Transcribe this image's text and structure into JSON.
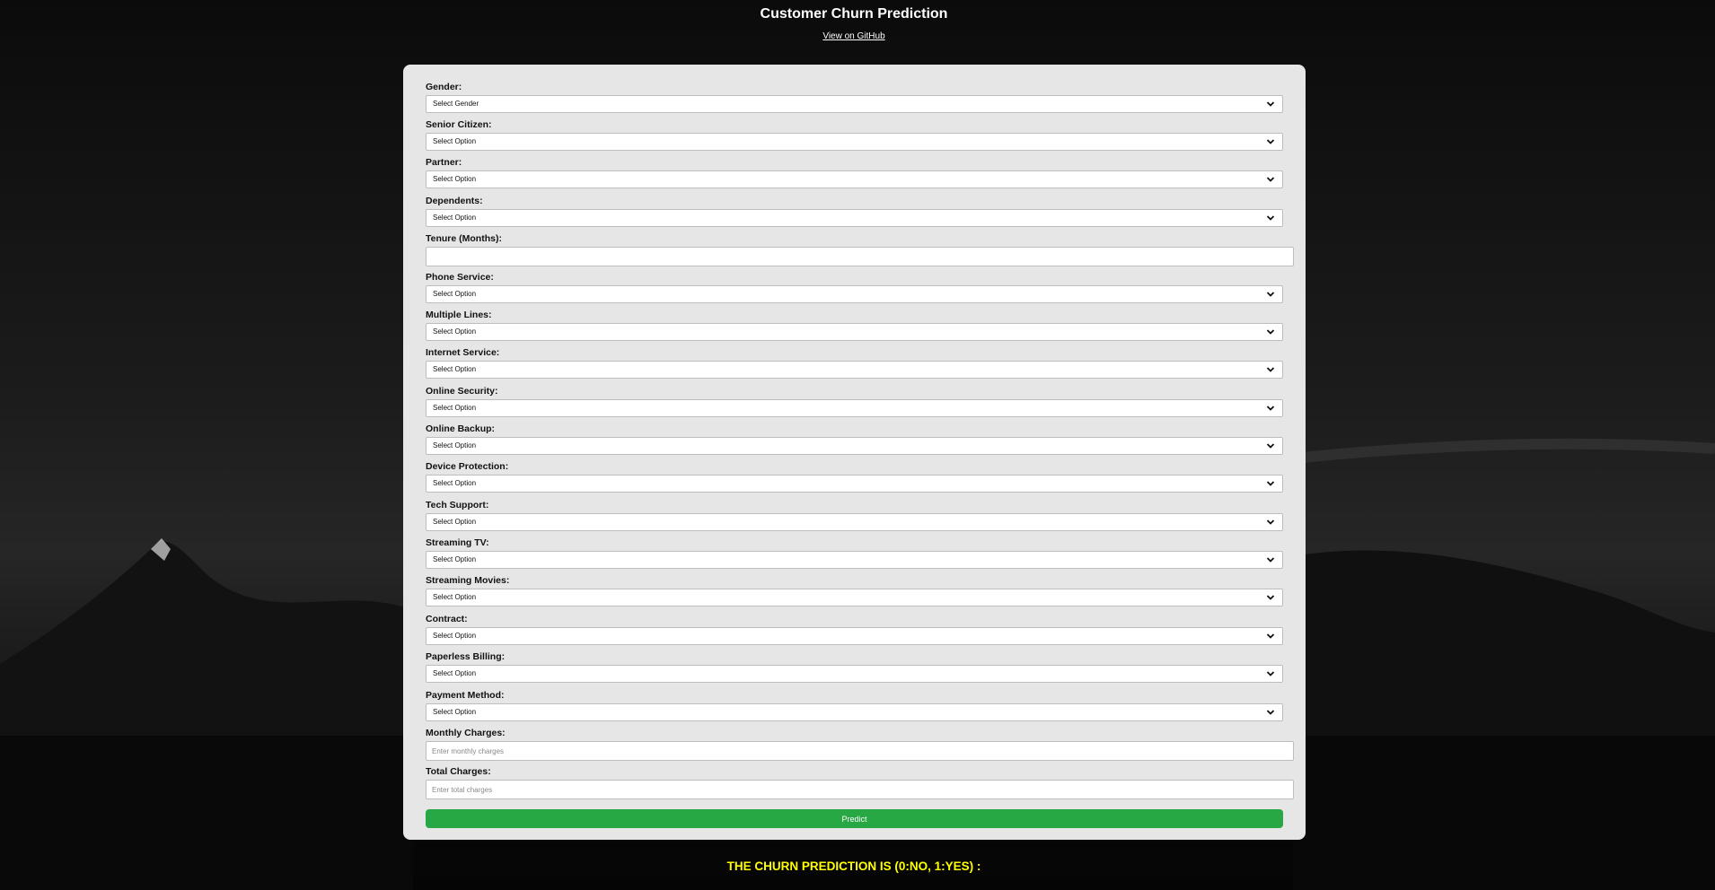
{
  "header": {
    "title": "Customer Churn Prediction",
    "github_link": "View on GitHub"
  },
  "form": {
    "fields": [
      {
        "label": "Gender:",
        "type": "select",
        "selected": "Select Gender"
      },
      {
        "label": "Senior Citizen:",
        "type": "select",
        "selected": "Select Option"
      },
      {
        "label": "Partner:",
        "type": "select",
        "selected": "Select Option"
      },
      {
        "label": "Dependents:",
        "type": "select",
        "selected": "Select Option"
      },
      {
        "label": "Tenure (Months):",
        "type": "input",
        "placeholder": "",
        "value": ""
      },
      {
        "label": "Phone Service:",
        "type": "select",
        "selected": "Select Option"
      },
      {
        "label": "Multiple Lines:",
        "type": "select",
        "selected": "Select Option"
      },
      {
        "label": "Internet Service:",
        "type": "select",
        "selected": "Select Option"
      },
      {
        "label": "Online Security:",
        "type": "select",
        "selected": "Select Option"
      },
      {
        "label": "Online Backup:",
        "type": "select",
        "selected": "Select Option"
      },
      {
        "label": "Device Protection:",
        "type": "select",
        "selected": "Select Option"
      },
      {
        "label": "Tech Support:",
        "type": "select",
        "selected": "Select Option"
      },
      {
        "label": "Streaming TV:",
        "type": "select",
        "selected": "Select Option"
      },
      {
        "label": "Streaming Movies:",
        "type": "select",
        "selected": "Select Option"
      },
      {
        "label": "Contract:",
        "type": "select",
        "selected": "Select Option"
      },
      {
        "label": "Paperless Billing:",
        "type": "select",
        "selected": "Select Option"
      },
      {
        "label": "Payment Method:",
        "type": "select",
        "selected": "Select Option"
      },
      {
        "label": "Monthly Charges:",
        "type": "input",
        "placeholder": "Enter monthly charges",
        "value": ""
      },
      {
        "label": "Total Charges:",
        "type": "input",
        "placeholder": "Enter total charges",
        "value": ""
      }
    ],
    "submit_label": "Predict"
  },
  "result": {
    "text": "THE CHURN PREDICTION IS (0:NO, 1:YES) :"
  },
  "colors": {
    "accent": "#28a745",
    "result_text": "#ffff00",
    "card_bg": "#e6e6e6"
  },
  "icons": {
    "select_arrow": "chevron-down-icon"
  }
}
